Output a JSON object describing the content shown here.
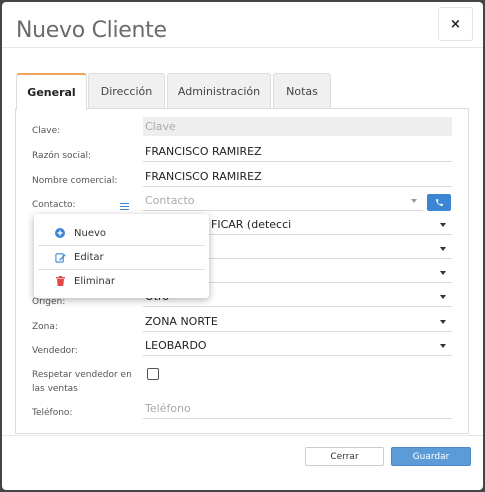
{
  "modal": {
    "title": "Nuevo Cliente",
    "close_label": "×"
  },
  "tabs": [
    {
      "label": "General",
      "active": true
    },
    {
      "label": "Dirección",
      "active": false
    },
    {
      "label": "Administración",
      "active": false
    },
    {
      "label": "Notas",
      "active": false
    }
  ],
  "form": {
    "clave": {
      "label": "Clave:",
      "placeholder": "Clave",
      "value": ""
    },
    "razon_social": {
      "label": "Razón social:",
      "value": "FRANCISCO RAMIREZ"
    },
    "nombre_comercial": {
      "label": "Nombre comercial:",
      "value": "FRANCISCO RAMIREZ"
    },
    "contacto": {
      "label": "Contacto:",
      "placeholder": "Contacto"
    },
    "partial_select": {
      "value": "FICAR (detecci"
    },
    "origen": {
      "label": "Origen:",
      "value": "Otro"
    },
    "zona": {
      "label": "Zona:",
      "value": "ZONA NORTE"
    },
    "vendedor": {
      "label": "Vendedor:",
      "value": "LEOBARDO"
    },
    "respetar": {
      "label_line1": "Respetar vendedor en",
      "label_line2": "las ventas",
      "checked": false
    },
    "telefono": {
      "label": "Teléfono:",
      "placeholder": "Teléfono"
    }
  },
  "contact_menu": {
    "items": [
      {
        "label": "Nuevo",
        "icon": "plus-circle-icon"
      },
      {
        "label": "Editar",
        "icon": "edit-icon"
      },
      {
        "label": "Eliminar",
        "icon": "trash-icon"
      }
    ]
  },
  "footer": {
    "cancel_label": "Cerrar",
    "save_label": "Guardar"
  },
  "colors": {
    "accent": "#3a86d4",
    "tab_active_border": "#f0a55a",
    "save_button": "#5b9bd8",
    "delete_icon": "#e04848"
  }
}
